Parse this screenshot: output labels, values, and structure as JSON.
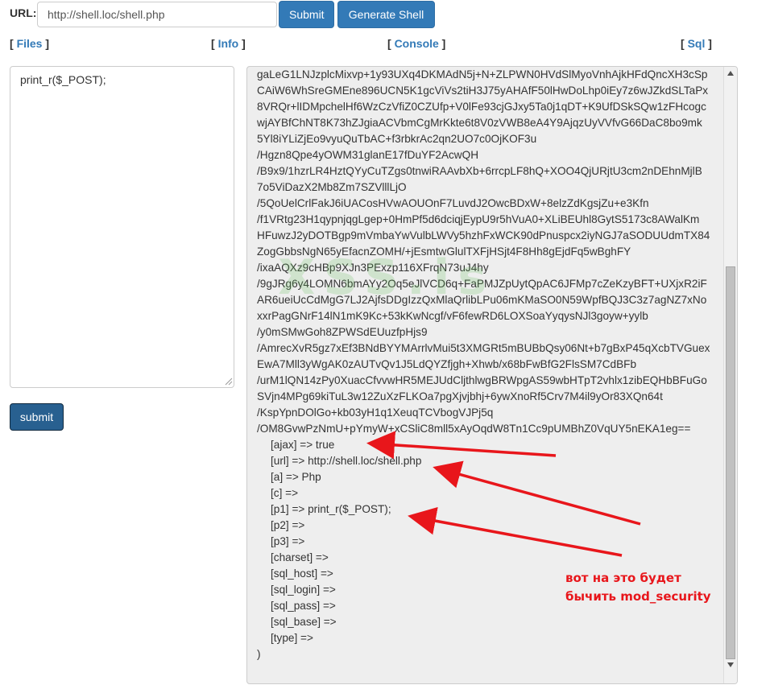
{
  "toolbar": {
    "url_label": "URL:",
    "url_value": "http://shell.loc/shell.php",
    "submit_label": "Submit",
    "generate_label": "Generate Shell"
  },
  "nav": [
    {
      "label": "Files"
    },
    {
      "label": "Info"
    },
    {
      "label": "Console"
    },
    {
      "label": "Sql"
    }
  ],
  "editor": {
    "code": "print_r($_POST);",
    "submit_label": "submit"
  },
  "output": {
    "lines": [
      "gaLeG1LNJzplcMixvp+1y93UXq4DKMAdN5j+N+ZLPWN0HVdSlMyoVnhAjkHFdQncXH3cSp",
      "CAiW6WhSreGMEne896UCN5K1gcViVs2tiH3J75yAHAfF50lHwDoLhp0iEy7z6wJZkdSLTaPx",
      "8VRQr+lIDMpchelHf6WzCzVfiZ0CZUfp+V0lFe93cjGJxy5Ta0j1qDT+K9UfDSkSQw1zFHcogc",
      "wjAYBfChNT8K73hZJgiaACVbmCgMrKkte6t8V0zVWB8eA4Y9AjqzUyVVfvG66DaC8bo9mk",
      "5Yl8iYLiZjEo9vyuQuTbAC+f3rbkrAc2qn2UO7c0OjKOF3u",
      "/Hgzn8Qpe4yOWM31glanE17fDuYF2AcwQH",
      "/B9x9/1hzrLR4HztQYyCuTZgs0tnwiRAAvbXb+6rrcpLF8hQ+XOO4QjURjtU3cm2nDEhnMjlB",
      "7o5ViDazX2Mb8Zm7SZVlllLjO",
      "/5QoUelCrlFakJ6iUACosHVwAOUOnF7LuvdJ2OwcBDxW+8elzZdKgsjZu+e3Kfn",
      "/f1VRtg23H1qypnjqgLgep+0HmPf5d6dciqjEypU9r5hVuA0+XLiBEUhl8GytS5173c8AWalKm",
      "HFuwzJ2yDOTBgp9mVmbaYwVulbLWVy5hzhFxWCK90dPnuspcx2iyNGJ7aSODUUdmTX84",
      "ZogGbbsNgN65yEfacnZOMH/+jEsmtwGlulTXFjHSjt4F8Hh8gEjdFq5wBghFY",
      "/ixaAQXz9cHBp9XJn3PExzp116XFrqN73uJ4hy",
      "/9gJRg6y4LOMN6bmAYy2Oq5eJlVCD6q+FaPMJZpUytQpAC6JFMp7cZeKzyBFT+UXjxR2iF",
      "AR6ueiUcCdMgG7LJ2AjfsDDgIzzQxMlaQrlibLPu06mKMaSO0N59WpfBQJ3C3z7agNZ7xNo",
      "xxrPagGNrF14lN1mK9Kc+53kKwNcgf/vF6fewRD6LOXSoaYyqysNJl3goyw+yylb",
      "/y0mSMwGoh8ZPWSdEUuzfpHjs9",
      "/AmrecXvR5gz7xEf3BNdBYYMArrlvMui5t3XMGRt5mBUBbQsy06Nt+b7gBxP45qXcbTVGuex",
      "EwA7Mll3yWgAK0zAUTvQv1J5LdQYZfjgh+Xhwb/x68bFwBfG2FlsSM7CdBFb",
      "/urM1lQN14zPy0XuacCfvvwHR5MEJUdCljthlwgBRWpgAS59wbHTpT2vhlx1zibEQHbBFuGo",
      "SVjn4MPg69kiTuL3w12ZuXzFLKOa7pgXjvjbhj+6ywXnoRf5Crv7M4il9yOr83XQn64t",
      "/KspYpnDOlGo+kb03yH1q1XeuqTCVbogVJPj5q",
      "/OM8GvwPzNmU+pYmyW+xCSliC8mll5xAyOqdW8Tn1Cc9pUMBhZ0VqUY5nEKA1eg=="
    ],
    "fields": [
      "[ajax] => true",
      "[url] => http://shell.loc/shell.php",
      "[a] => Php",
      "[c] =>",
      "[p1] => print_r($_POST);",
      "[p2] =>",
      "[p3] =>",
      "[charset] =>",
      "[sql_host] =>",
      "[sql_login] =>",
      "[sql_pass] =>",
      "[sql_base] =>",
      "[type] =>"
    ],
    "closing": ")"
  },
  "watermark": "XSS.is",
  "annotation": "вот на это будет\nбычить mod_security",
  "colors": {
    "primary": "#337ab7",
    "primary_dark": "#286090",
    "annotation_red": "#e8161b",
    "output_bg": "#eeeeee"
  }
}
